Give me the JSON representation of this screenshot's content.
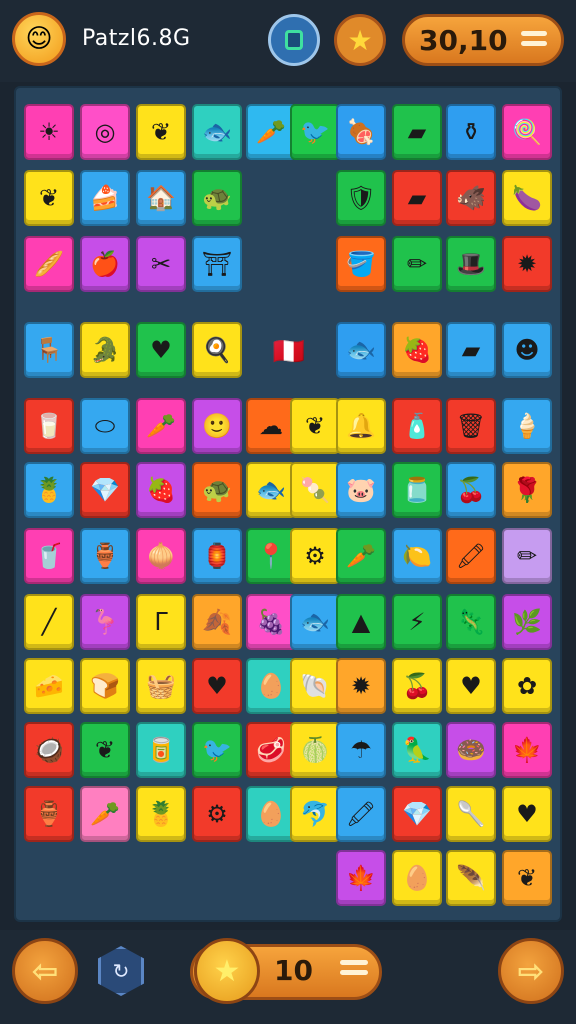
{
  "header": {
    "title": "Patzl6.8G",
    "avatar_icon": "sun-face-icon",
    "avatar_glyph": "😊",
    "map_icon": "map-icon",
    "star_glyph": "★",
    "score": "30,10",
    "menu_icon": "menu-lines-icon"
  },
  "footer": {
    "back_glyph": "⇦",
    "next_glyph": "⇨",
    "hint_glyph": "↻",
    "coin_glyph": "★",
    "count": "10"
  },
  "colors": {
    "board": "#28445c",
    "accent_orange": "#e08a2a"
  },
  "board": {
    "flag_glyph": "🇵🇪",
    "rows": [
      [
        [
          "#ff3fb3",
          "☀"
        ],
        [
          "#ff4fc8",
          "◎"
        ],
        [
          "#ffe21b",
          "❦"
        ],
        [
          "#2fd0c0",
          "🐟"
        ],
        [
          "#2fb9f0",
          "🥕"
        ],
        [
          "#1fc84a",
          "🐦"
        ],
        [
          "#2f9ef0",
          "🍖"
        ],
        [
          "#20c24c",
          "▰"
        ],
        [
          "#2f9ef0",
          "⚱"
        ],
        [
          "#ff3fb3",
          "🍭"
        ]
      ],
      [
        [
          "#ffe21b",
          "❦"
        ],
        [
          "#35a8f0",
          "🍰"
        ],
        [
          "#35a8f0",
          "🏠"
        ],
        [
          "#20c24c",
          "🐢"
        ],
        null,
        null,
        [
          "#20c24c",
          "🛡"
        ],
        [
          "#f23a2a",
          "▰"
        ],
        [
          "#f23a2a",
          "🐗"
        ],
        [
          "#ffe21b",
          "🍆"
        ]
      ],
      [
        [
          "#ff3fb3",
          "🥖"
        ],
        [
          "#c64ee8",
          "🍎"
        ],
        [
          "#c64ee8",
          "✂"
        ],
        [
          "#35a8f0",
          "⛩"
        ],
        null,
        null,
        [
          "#ff6a1a",
          "🪣"
        ],
        [
          "#20c24c",
          "✏"
        ],
        [
          "#20c24c",
          "🎩"
        ],
        [
          "#f23a2a",
          "✹"
        ]
      ],
      [
        [
          "#35a8f0",
          "🪑"
        ],
        [
          "#ffe21b",
          "🐊"
        ],
        [
          "#20c24c",
          "♥"
        ],
        [
          "#ffe21b",
          "🍳"
        ],
        null,
        null,
        [
          "#2f9ef0",
          "🐟"
        ],
        [
          "#ffa62a",
          "🍓"
        ],
        [
          "#35a8f0",
          "▰"
        ],
        [
          "#35a8f0",
          "☻"
        ]
      ],
      [
        [
          "#f23a2a",
          "🥛"
        ],
        [
          "#35a8f0",
          "⬭"
        ],
        [
          "#ff3fb3",
          "🥕"
        ],
        [
          "#c64ee8",
          "🙂"
        ],
        [
          "#ff6a1a",
          "☁"
        ],
        [
          "#ffe21b",
          "❦"
        ],
        [
          "#ffe21b",
          "🔔"
        ],
        [
          "#f23a2a",
          "🧴"
        ],
        [
          "#f23a2a",
          "🗑"
        ],
        [
          "#35a8f0",
          "🍦"
        ]
      ],
      [
        [
          "#35a8f0",
          "🍍"
        ],
        [
          "#f23a2a",
          "💎"
        ],
        [
          "#c64ee8",
          "🍓"
        ],
        [
          "#ff6a1a",
          "🐢"
        ],
        [
          "#ffe21b",
          "🐟"
        ],
        [
          "#ffe21b",
          "🍡"
        ],
        [
          "#35a8f0",
          "🐷"
        ],
        [
          "#20c24c",
          "🫙"
        ],
        [
          "#35a8f0",
          "🍒"
        ],
        [
          "#ffa62a",
          "🌹"
        ]
      ],
      [
        [
          "#ff3fb3",
          "🥤"
        ],
        [
          "#35a8f0",
          "🏺"
        ],
        [
          "#ff3fb3",
          "🧅"
        ],
        [
          "#35a8f0",
          "🏮"
        ],
        [
          "#20c24c",
          "📍"
        ],
        [
          "#ffe21b",
          "⚙"
        ],
        [
          "#20c24c",
          "🥕"
        ],
        [
          "#35a8f0",
          "🍋"
        ],
        [
          "#ff6a1a",
          "🖍"
        ],
        [
          "#c69cf0",
          "✏"
        ]
      ],
      [
        [
          "#ffe21b",
          "╱"
        ],
        [
          "#c64ee8",
          "🦩"
        ],
        [
          "#ffe21b",
          "ᒥ"
        ],
        [
          "#ffa62a",
          "🍂"
        ],
        [
          "#ff4fc8",
          "🍇"
        ],
        [
          "#35a8f0",
          "🐟"
        ],
        [
          "#20c24c",
          "▲"
        ],
        [
          "#20c24c",
          "⚡"
        ],
        [
          "#20c24c",
          "🦎"
        ],
        [
          "#c64ee8",
          "🌿"
        ]
      ],
      [
        [
          "#ffe21b",
          "🧀"
        ],
        [
          "#ffe21b",
          "🍞"
        ],
        [
          "#ffe21b",
          "🧺"
        ],
        [
          "#f23a2a",
          "♥"
        ],
        [
          "#2fd0c0",
          "🥚"
        ],
        [
          "#ffe21b",
          "🐚"
        ],
        [
          "#ffa62a",
          "✹"
        ],
        [
          "#ffe21b",
          "🍒"
        ],
        [
          "#ffe21b",
          "♥"
        ],
        [
          "#ffe21b",
          "✿"
        ]
      ],
      [
        [
          "#f23a2a",
          "🥥"
        ],
        [
          "#20c24c",
          "❦"
        ],
        [
          "#2fd0c0",
          "🥫"
        ],
        [
          "#20c24c",
          "🐦"
        ],
        [
          "#f23a2a",
          "🥩"
        ],
        [
          "#ffe21b",
          "🍈"
        ],
        [
          "#35a8f0",
          "☂"
        ],
        [
          "#2fd0c0",
          "🦜"
        ],
        [
          "#c64ee8",
          "🍩"
        ],
        [
          "#ff3fb3",
          "🍁"
        ]
      ],
      [
        [
          "#f23a2a",
          "🏺"
        ],
        [
          "#ff7fc0",
          "🥕"
        ],
        [
          "#ffe21b",
          "🍍"
        ],
        [
          "#f23a2a",
          "⚙"
        ],
        [
          "#2fd0c0",
          "🥚"
        ],
        [
          "#ffe21b",
          "🐬"
        ],
        [
          "#35a8f0",
          "🖍"
        ],
        [
          "#f23a2a",
          "💎"
        ],
        [
          "#ffe21b",
          "🥄"
        ],
        [
          "#ffe21b",
          "♥"
        ]
      ],
      [
        null,
        null,
        null,
        null,
        null,
        null,
        [
          "#c64ee8",
          "🍁"
        ],
        [
          "#ffe21b",
          "🥚"
        ],
        [
          "#ffe21b",
          "🪶"
        ],
        [
          "#ffa62a",
          "❦"
        ]
      ]
    ]
  }
}
